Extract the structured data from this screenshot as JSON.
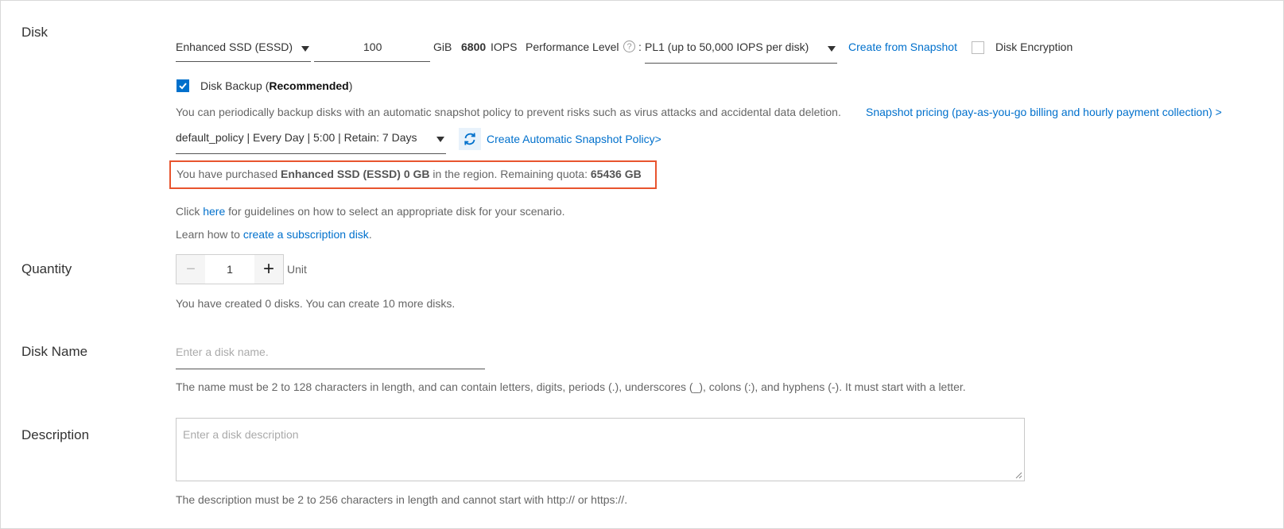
{
  "disk": {
    "label": "Disk",
    "type_value": "Enhanced SSD (ESSD)",
    "size_value": "100",
    "size_unit": "GiB",
    "iops_value": "6800",
    "iops_unit": "IOPS",
    "performance_level_label": "Performance Level",
    "performance_level_help": "?",
    "performance_level_colon": ":",
    "performance_level_value": "PL1 (up to 50,000 IOPS per disk)",
    "create_from_snapshot_link": "Create from Snapshot",
    "encryption_label": "Disk Encryption",
    "backup_label": "Disk Backup (",
    "backup_recommended": "Recommended",
    "backup_label_close": ")",
    "backup_description": "You can periodically backup disks with an automatic snapshot policy to prevent risks such as virus attacks and accidental data deletion.",
    "snapshot_pricing_link": "Snapshot pricing (pay-as-you-go billing and hourly payment collection) >",
    "policy_value": "default_policy | Every Day | 5:00 | Retain: 7 Days",
    "create_policy_link": "Create Automatic Snapshot Policy>",
    "quota_prefix": "You have purchased ",
    "quota_purchased": "Enhanced SSD (ESSD) 0 GB",
    "quota_middle": " in the region. Remaining quota: ",
    "quota_remaining": "65436 GB",
    "guide_prefix": "Click ",
    "guide_link": "here",
    "guide_suffix": " for guidelines on how to select an appropriate disk for your scenario.",
    "learn_prefix": "Learn how to ",
    "learn_link": "create a subscription disk",
    "learn_suffix": "."
  },
  "quantity": {
    "label": "Quantity",
    "minus": "−",
    "value": "1",
    "plus": "+",
    "unit": "Unit",
    "note": "You have created 0 disks. You can create 10 more disks."
  },
  "disk_name": {
    "label": "Disk Name",
    "placeholder": "Enter a disk name.",
    "note": "The name must be 2 to 128 characters in length, and can contain letters, digits, periods (.), underscores (_), colons (:), and hyphens (-). It must start with a letter."
  },
  "description": {
    "label": "Description",
    "placeholder": "Enter a disk description",
    "note": "The description must be 2 to 256 characters in length and cannot start with http:// or https://."
  },
  "colors": {
    "accent": "#0070cc",
    "highlight_border": "#e8542e"
  },
  "icons": {
    "refresh": "refresh-icon",
    "dropdown": "chevron-down-icon",
    "check": "check-icon"
  }
}
